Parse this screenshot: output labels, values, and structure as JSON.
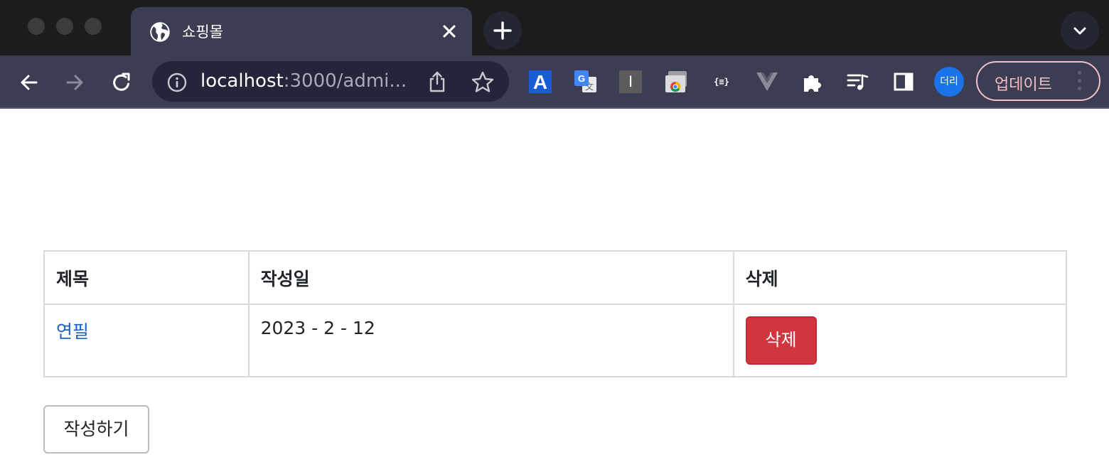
{
  "browser": {
    "tab": {
      "title": "쇼핑몰",
      "icon": "globe-icon"
    },
    "address": {
      "host": "localhost",
      "rest": ":3000/admi..."
    },
    "profile": {
      "initials": "더리"
    },
    "update_label": "업데이트",
    "extensions": [
      {
        "name": "a-extension-icon",
        "text": "A"
      },
      {
        "name": "google-translate-icon",
        "text": "G"
      },
      {
        "name": "i-extension-icon",
        "text": "I"
      },
      {
        "name": "chrome-cast-icon"
      },
      {
        "name": "json-formatter-icon",
        "text": "{≡}"
      },
      {
        "name": "vue-devtools-icon"
      },
      {
        "name": "puzzle-icon"
      },
      {
        "name": "reading-list-icon"
      },
      {
        "name": "side-panel-icon"
      }
    ]
  },
  "table": {
    "headers": {
      "title": "제목",
      "date": "작성일",
      "delete": "삭제"
    },
    "rows": [
      {
        "title": "연필",
        "date": "2023 - 2 - 12",
        "delete_label": "삭제"
      }
    ]
  },
  "write_button": "작성하기",
  "colors": {
    "tab_bar": "#1c1c1e",
    "toolbar": "#3b3d52",
    "link": "#1a62c6",
    "danger": "#d1363f",
    "update_accent": "#f5bfc4",
    "profile": "#1a73e8"
  }
}
